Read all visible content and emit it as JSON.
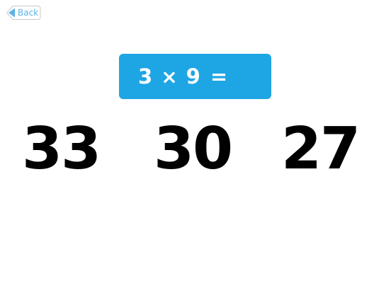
{
  "header": {
    "back_label": "Back"
  },
  "question": {
    "operand_a": "3",
    "operator": "×",
    "operand_b": "9",
    "equals": "="
  },
  "answers": [
    "33",
    "30",
    "27"
  ],
  "colors": {
    "equation_background": "#1ea5e4",
    "equation_text": "#ffffff",
    "back_accent": "#5cb4e6",
    "answer_text": "#000000"
  },
  "icons": {
    "back": "arrow-left-icon"
  }
}
